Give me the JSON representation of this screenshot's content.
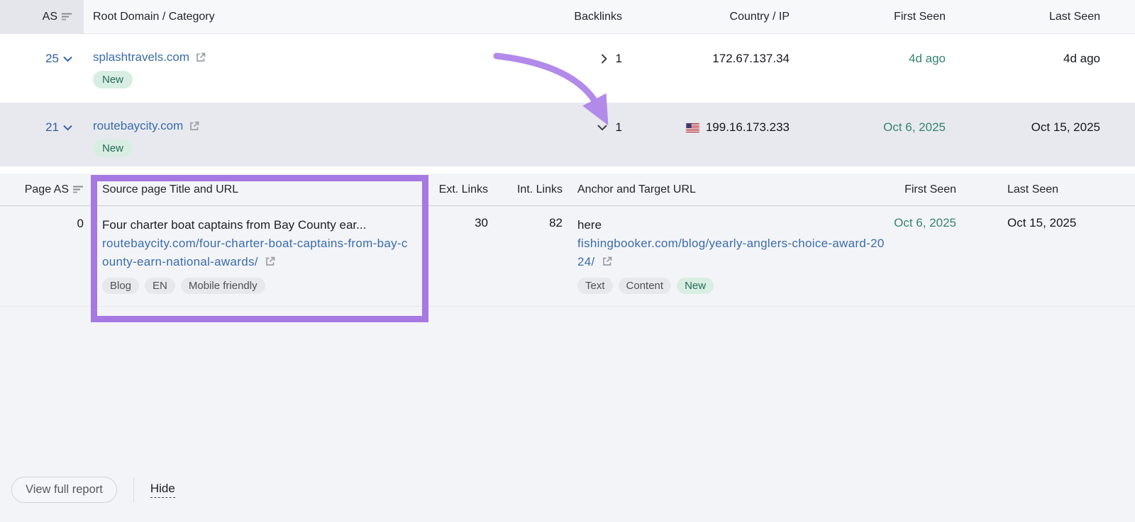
{
  "colors": {
    "link_blue": "#3a6cab",
    "as_blue": "#2f5e9e",
    "date_teal": "#35836f",
    "annotation_purple": "#a678e2",
    "arrow_purple": "#b28ae9",
    "badge_green_bg": "#d9eee3",
    "badge_green_text": "#256a58"
  },
  "main_table": {
    "header": {
      "as": "AS",
      "root_domain": "Root Domain / Category",
      "backlinks": "Backlinks",
      "country_ip": "Country / IP",
      "first_seen": "First Seen",
      "last_seen": "Last Seen"
    },
    "rows": [
      {
        "as": "25",
        "domain": "splashtravels.com",
        "category_badge": "New",
        "backlinks": "1",
        "ip": "172.67.137.34",
        "first_seen": "4d ago",
        "last_seen": "4d ago"
      },
      {
        "as": "21",
        "domain": "routebaycity.com",
        "category_badge": "New",
        "backlinks": "1",
        "ip": "199.16.173.233",
        "first_seen": "Oct 6, 2025",
        "last_seen": "Oct 15, 2025"
      }
    ]
  },
  "nested_table": {
    "header": {
      "page_as": "Page AS",
      "source": "Source page Title and URL",
      "ext_links": "Ext. Links",
      "int_links": "Int. Links",
      "anchor": "Anchor and Target URL",
      "first_seen": "First Seen",
      "last_seen": "Last Seen"
    },
    "row": {
      "page_as": "0",
      "title": "Four charter boat captains from Bay County ear...",
      "source_url": "routebaycity.com/four-charter-boat-captains-from-bay-county-earn-national-awards/",
      "source_badges": [
        "Blog",
        "EN",
        "Mobile friendly"
      ],
      "ext_links": "30",
      "int_links": "82",
      "anchor_text": "here",
      "target_url": "fishingbooker.com/blog/yearly-anglers-choice-award-2024/",
      "target_badges": [
        "Text",
        "Content",
        "New"
      ],
      "first_seen": "Oct 6, 2025",
      "last_seen": "Oct 15, 2025"
    }
  },
  "footer": {
    "view_full_report": "View full report",
    "hide": "Hide"
  }
}
